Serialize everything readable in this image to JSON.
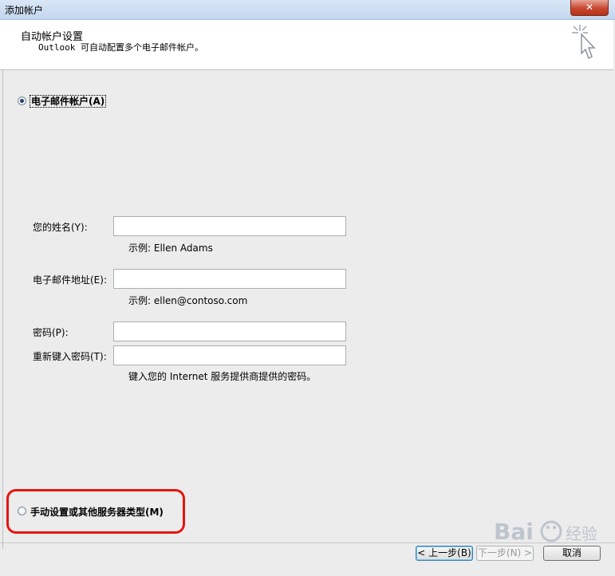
{
  "window": {
    "title": "添加帐户",
    "close_label": "✕"
  },
  "header": {
    "title": "自动帐户设置",
    "subtitle": "Outlook 可自动配置多个电子邮件帐户。"
  },
  "options": {
    "email_account": "电子邮件帐户(A)",
    "manual": "手动设置或其他服务器类型(M)"
  },
  "form": {
    "name_label": "您的姓名(Y):",
    "name_value": "",
    "name_hint": "示例: Ellen Adams",
    "email_label": "电子邮件地址(E):",
    "email_value": "",
    "email_hint": "示例: ellen@contoso.com",
    "password_label": "密码(P):",
    "password_value": "",
    "retype_label": "重新键入密码(T):",
    "retype_value": "",
    "password_hint": "键入您的 Internet 服务提供商提供的密码。"
  },
  "buttons": {
    "back": "< 上一步(B)",
    "next": "下一步(N) >",
    "cancel": "取消"
  },
  "watermark": "Bai 经验"
}
